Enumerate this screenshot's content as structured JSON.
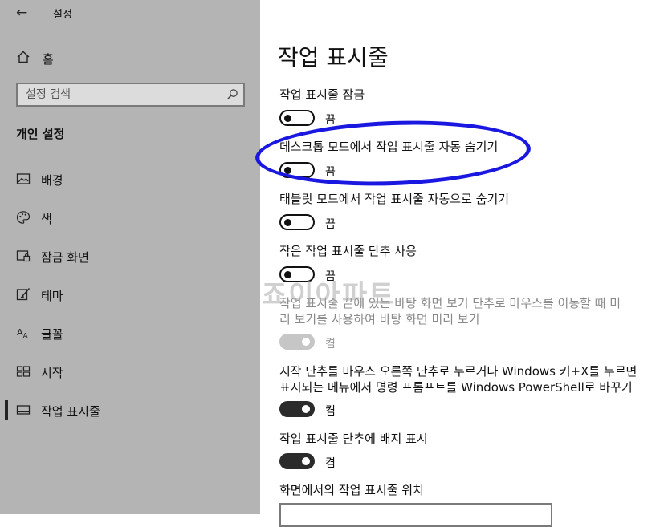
{
  "app": {
    "title": "설정",
    "back_icon": "back-arrow-icon"
  },
  "sidebar": {
    "home_label": "홈",
    "search_placeholder": "설정 검색",
    "section_title": "개인 설정",
    "items": [
      {
        "label": "배경",
        "icon": "picture-icon"
      },
      {
        "label": "색",
        "icon": "palette-icon"
      },
      {
        "label": "잠금 화면",
        "icon": "lock-screen-icon"
      },
      {
        "label": "테마",
        "icon": "theme-brush-icon"
      },
      {
        "label": "글꼴",
        "icon": "font-icon"
      },
      {
        "label": "시작",
        "icon": "start-tiles-icon"
      },
      {
        "label": "작업 표시줄",
        "icon": "taskbar-icon",
        "active": true
      }
    ]
  },
  "main": {
    "title": "작업 표시줄",
    "settings": [
      {
        "label": "작업 표시줄 잠금",
        "state": "끔",
        "on": false
      },
      {
        "label": "데스크톱 모드에서 작업 표시줄 자동 숨기기",
        "state": "끔",
        "on": false
      },
      {
        "label": "태블릿 모드에서 작업 표시줄 자동으로 숨기기",
        "state": "끔",
        "on": false
      },
      {
        "label": "작은 작업 표시줄 단추 사용",
        "state": "끔",
        "on": false
      },
      {
        "label_line1": "작업 표시줄 끝에 있는 바탕 화면 보기 단추로 마우스를 이동할 때 미",
        "label_line2": "리 보기를 사용하여 바탕 화면 미리 보기",
        "state": "켬",
        "on": true,
        "disabled": true
      },
      {
        "label_line1": "시작 단추를 마우스 오른쪽 단추로 누르거나 Windows 키+X를 누르면",
        "label_line2": "표시되는 메뉴에서 명령 프롬프트를 Windows PowerShell로 바꾸기",
        "state": "켬",
        "on": true
      },
      {
        "label": "작업 표시줄 단추에 배지 표시",
        "state": "켬",
        "on": true
      }
    ],
    "position_label": "화면에서의 작업 표시줄 위치"
  },
  "watermark": "죠이아파트",
  "colors": {
    "sidebar_bg": "#b4b4b4",
    "annotation_ring": "#1a17e0",
    "toggle_on": "#2b2b2b"
  }
}
